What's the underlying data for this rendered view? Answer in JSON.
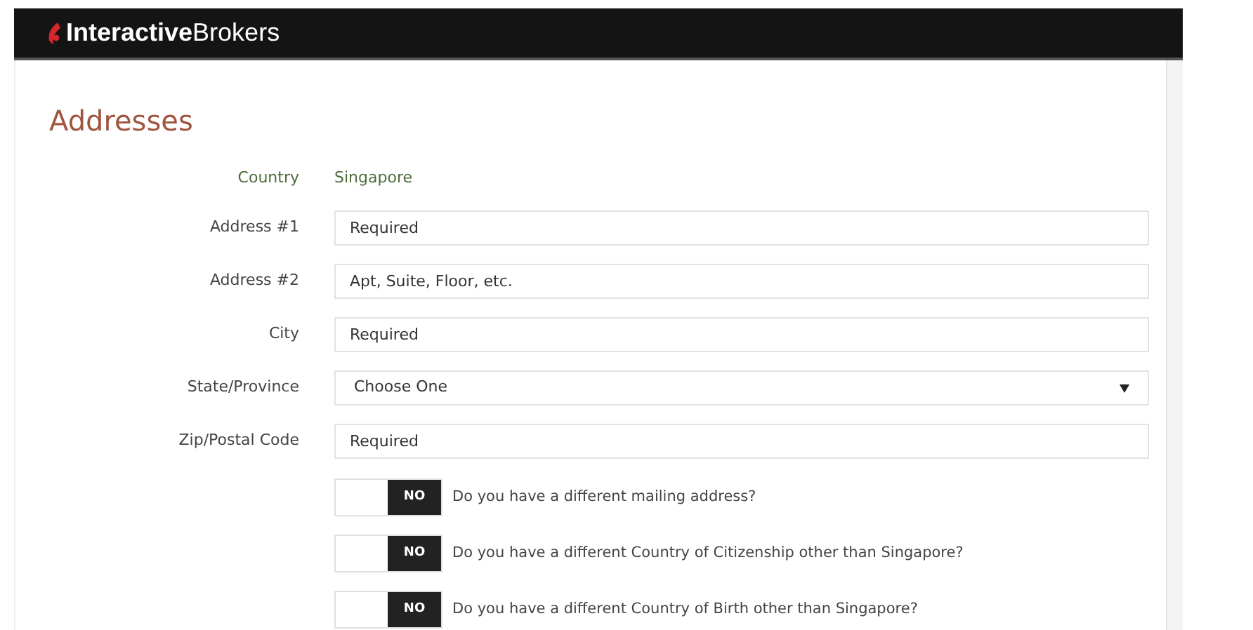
{
  "header": {
    "logo": "**Interactive**Brokers"
  },
  "section": {
    "title": "Addresses"
  },
  "country": {
    "label": "Country",
    "value": "Singapore"
  },
  "fields": [
    {
      "kind": "text",
      "label": "Address #1",
      "placeholder": "Required"
    },
    {
      "kind": "text",
      "label": "Address #2",
      "placeholder": "Apt, Suite, Floor, etc."
    },
    {
      "kind": "text",
      "label": "City",
      "placeholder": "Required"
    },
    {
      "kind": "select",
      "label": "State/Province",
      "value": "Choose One"
    },
    {
      "kind": "text",
      "label": "Zip/Postal Code",
      "placeholder": "Required"
    }
  ],
  "questions": [
    {
      "on": false,
      "toggle_label": "NO",
      "text": "Do you have a different mailing address?"
    },
    {
      "on": false,
      "toggle_label": "NO",
      "text": "Do you have a different Country of Citizenship other than Singapore?"
    },
    {
      "on": false,
      "toggle_label": "NO",
      "text": "Do you have a different Country of Birth other than Singapore?"
    }
  ]
}
